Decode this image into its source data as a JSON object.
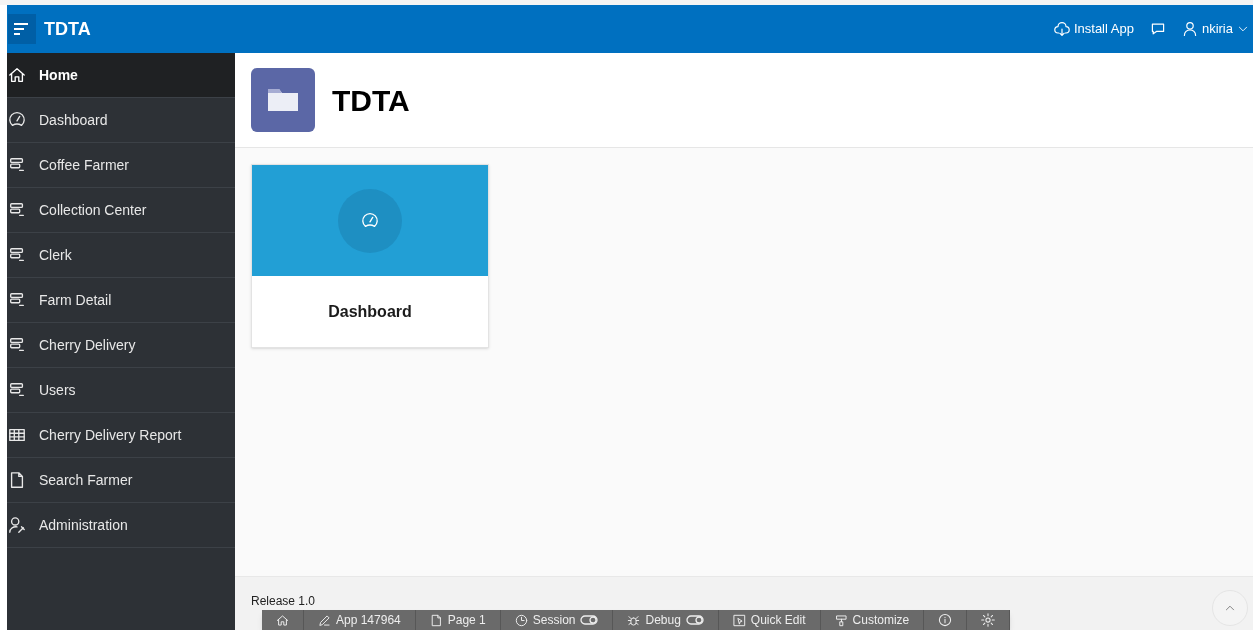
{
  "header": {
    "app_name": "TDTA",
    "install_label": "Install App",
    "user_name": "nkiria"
  },
  "sidebar": {
    "items": [
      {
        "label": "Home",
        "kind": "home",
        "selected": true
      },
      {
        "label": "Dashboard",
        "kind": "dashboard",
        "selected": false
      },
      {
        "label": "Coffee Farmer",
        "kind": "form",
        "selected": false
      },
      {
        "label": "Collection Center",
        "kind": "form",
        "selected": false
      },
      {
        "label": "Clerk",
        "kind": "form",
        "selected": false
      },
      {
        "label": "Farm Detail",
        "kind": "form",
        "selected": false
      },
      {
        "label": "Cherry Delivery",
        "kind": "form",
        "selected": false
      },
      {
        "label": "Users",
        "kind": "form",
        "selected": false
      },
      {
        "label": "Cherry Delivery Report",
        "kind": "report",
        "selected": false
      },
      {
        "label": "Search Farmer",
        "kind": "page",
        "selected": false
      },
      {
        "label": "Administration",
        "kind": "admin",
        "selected": false
      }
    ]
  },
  "page_title": "TDTA",
  "cards": [
    {
      "label": "Dashboard"
    }
  ],
  "footer": {
    "release": "Release 1.0"
  },
  "dev_toolbar": [
    {
      "kind": "home"
    },
    {
      "kind": "edit",
      "label": "App 147964"
    },
    {
      "kind": "page",
      "label": "Page 1"
    },
    {
      "kind": "session",
      "label": "Session"
    },
    {
      "kind": "debug",
      "label": "Debug"
    },
    {
      "kind": "quickedit",
      "label": "Quick Edit"
    },
    {
      "kind": "customize",
      "label": "Customize"
    },
    {
      "kind": "info"
    },
    {
      "kind": "settings"
    }
  ]
}
